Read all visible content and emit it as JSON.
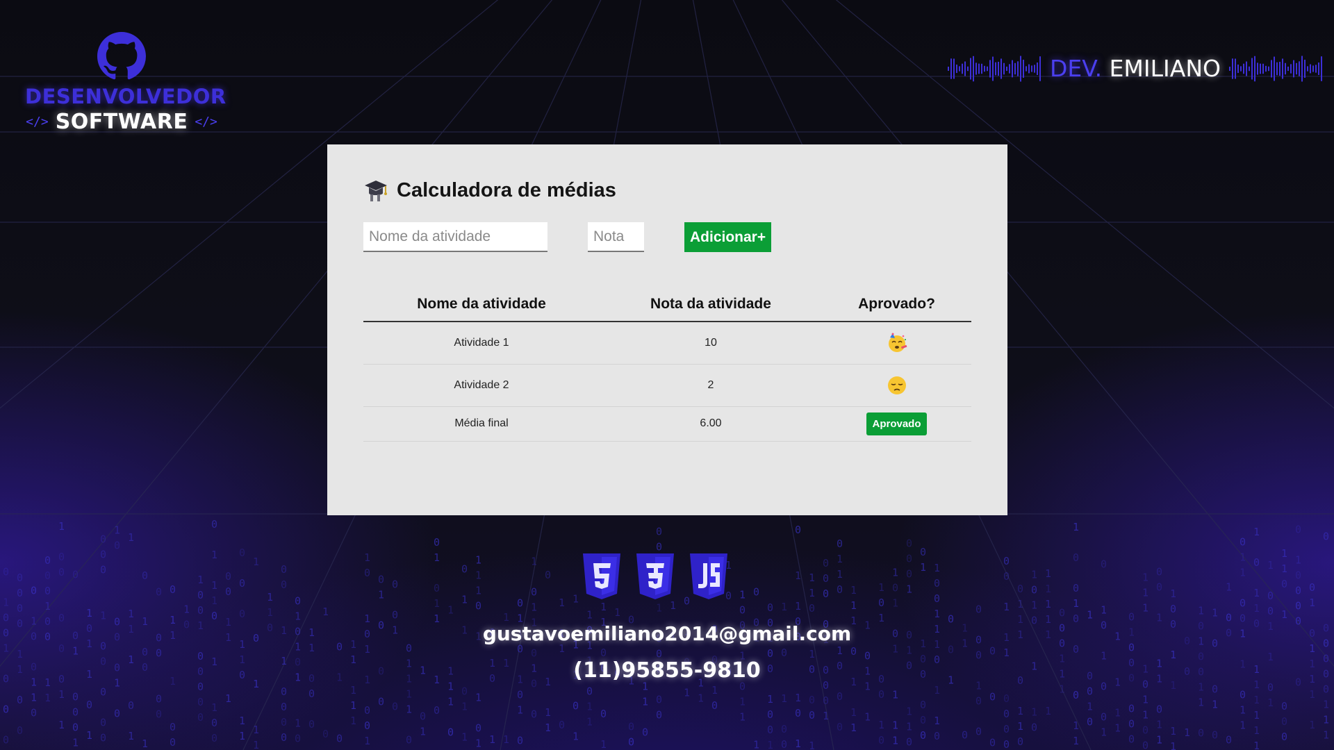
{
  "branding": {
    "line1": "DESENVOLVEDOR",
    "line2": "SOFTWARE",
    "code_tag_open": "</>",
    "code_tag_close": "</>",
    "logo_icon": "github-icon"
  },
  "dev_badge": {
    "prefix": "DEV.",
    "name": "EMILIANO"
  },
  "app": {
    "title": "Calculadora de médias",
    "title_icon": "graduation-cap-icon",
    "form": {
      "activity_name_placeholder": "Nome da atividade",
      "grade_placeholder": "Nota",
      "add_button_label": "Adicionar+"
    },
    "table": {
      "headers": [
        "Nome da atividade",
        "Nota da atividade",
        "Aprovado?"
      ],
      "rows": [
        {
          "name": "Atividade 1",
          "grade": "10",
          "status_icon": "celebrating-face-emoji"
        },
        {
          "name": "Atividade 2",
          "grade": "2",
          "status_icon": "pensive-face-emoji"
        }
      ],
      "final_row": {
        "label": "Média final",
        "value": "6.00",
        "status": "Aprovado"
      }
    }
  },
  "footer": {
    "tech_icons": [
      "html5-icon",
      "css3-icon",
      "javascript-icon"
    ],
    "email": "gustavoemiliano2014@gmail.com",
    "phone": "(11)95855-9810"
  },
  "colors": {
    "accent_blue": "#4b3ff0",
    "approve_green": "#0b9e36",
    "card_bg": "#e6e6e6",
    "page_bg": "#0e0e18"
  }
}
